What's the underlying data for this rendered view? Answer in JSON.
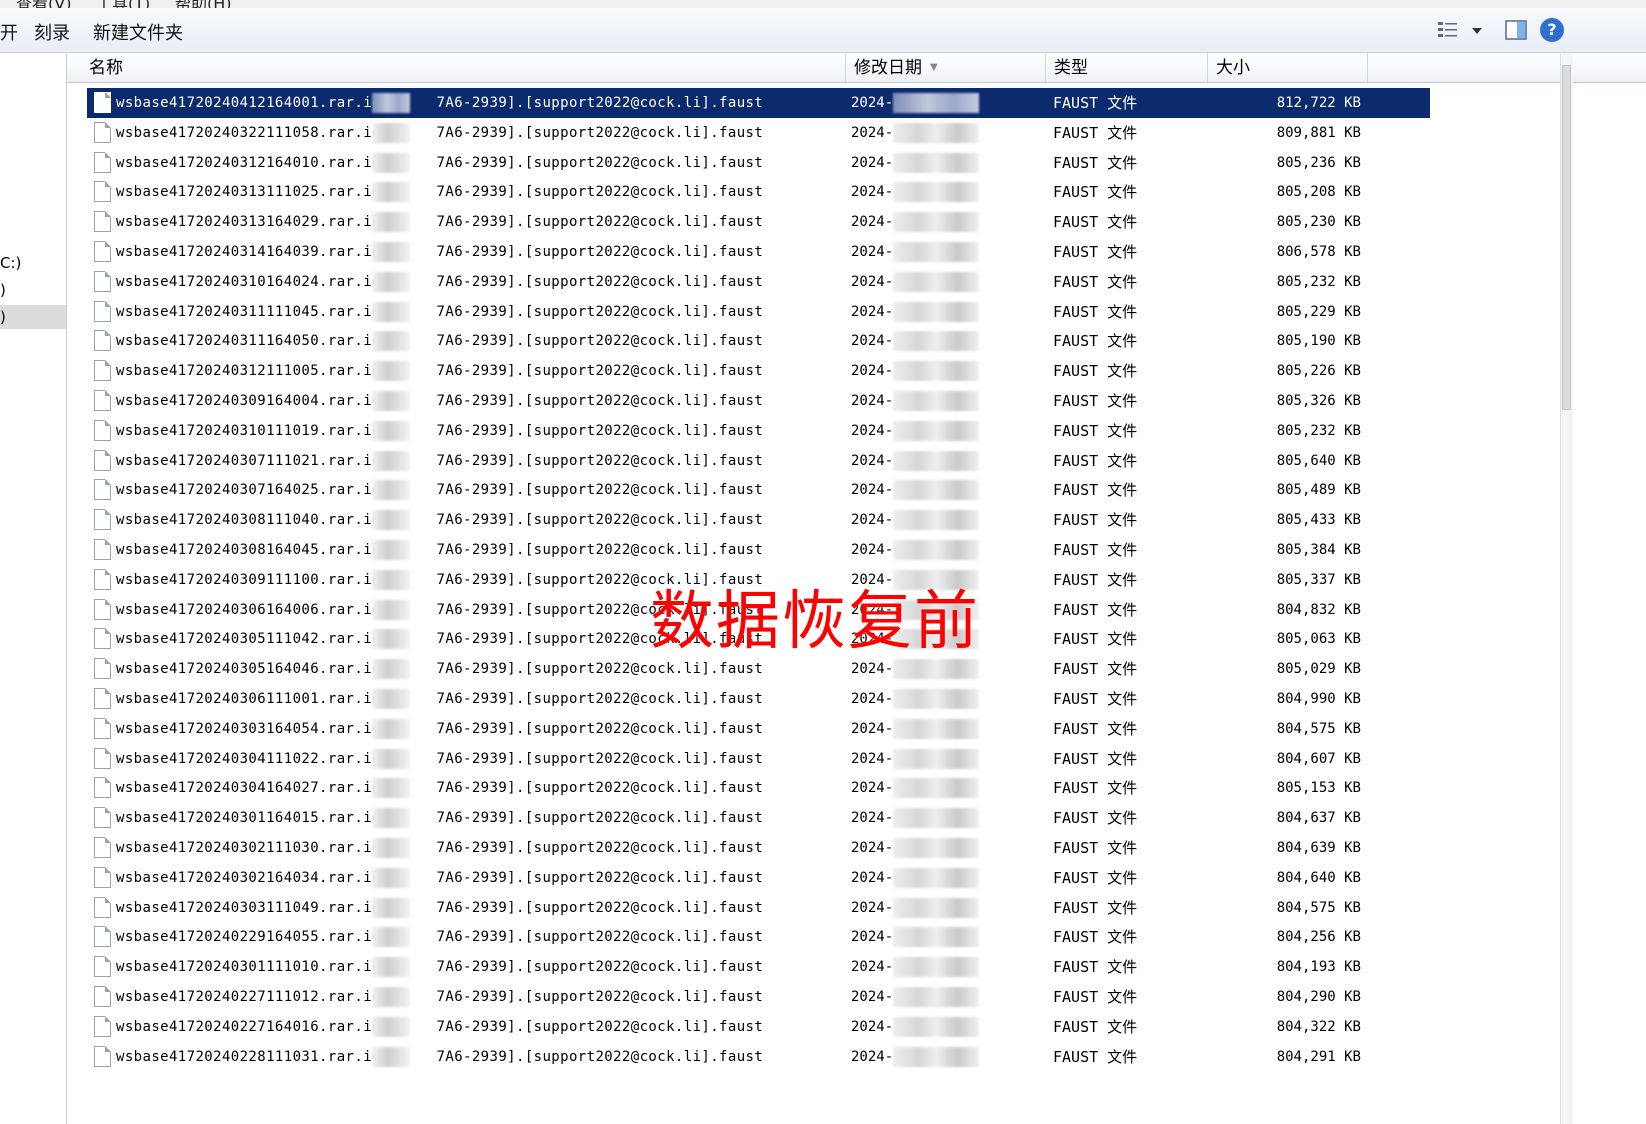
{
  "menubar": [
    "查看(V)",
    "工具(T)",
    "帮助(H)"
  ],
  "toolbar": {
    "open_label": "开",
    "burn_label": "刻录",
    "new_folder_label": "新建文件夹",
    "view_icon": "view-options-icon",
    "help_label": "?"
  },
  "nav": {
    "items": [
      "C:)",
      ")",
      ")"
    ]
  },
  "columns": {
    "name": "名称",
    "date": "修改日期",
    "type": "类型",
    "size": "大小"
  },
  "files": [
    {
      "name": "wsbase41720240412164001.rar.id[8",
      "suffix": "7A6-2939].[support2022@cock.li].faust",
      "date": "2024-",
      "type": "FAUST 文件",
      "size": "812,722 KB",
      "selected": true
    },
    {
      "name": "wsbase41720240322111058.rar.id[8",
      "suffix": "7A6-2939].[support2022@cock.li].faust",
      "date": "2024-",
      "type": "FAUST 文件",
      "size": "809,881 KB"
    },
    {
      "name": "wsbase41720240312164010.rar.id[8",
      "suffix": "7A6-2939].[support2022@cock.li].faust",
      "date": "2024-",
      "type": "FAUST 文件",
      "size": "805,236 KB"
    },
    {
      "name": "wsbase41720240313111025.rar.id[8",
      "suffix": "7A6-2939].[support2022@cock.li].faust",
      "date": "2024-",
      "type": "FAUST 文件",
      "size": "805,208 KB"
    },
    {
      "name": "wsbase41720240313164029.rar.id[8",
      "suffix": "7A6-2939].[support2022@cock.li].faust",
      "date": "2024-",
      "type": "FAUST 文件",
      "size": "805,230 KB"
    },
    {
      "name": "wsbase41720240314164039.rar.id[8",
      "suffix": "7A6-2939].[support2022@cock.li].faust",
      "date": "2024-",
      "type": "FAUST 文件",
      "size": "806,578 KB"
    },
    {
      "name": "wsbase41720240310164024.rar.id[8",
      "suffix": "7A6-2939].[support2022@cock.li].faust",
      "date": "2024-",
      "type": "FAUST 文件",
      "size": "805,232 KB"
    },
    {
      "name": "wsbase41720240311111045.rar.id[8",
      "suffix": "7A6-2939].[support2022@cock.li].faust",
      "date": "2024-",
      "type": "FAUST 文件",
      "size": "805,229 KB"
    },
    {
      "name": "wsbase41720240311164050.rar.id[8",
      "suffix": "7A6-2939].[support2022@cock.li].faust",
      "date": "2024-",
      "type": "FAUST 文件",
      "size": "805,190 KB"
    },
    {
      "name": "wsbase41720240312111005.rar.id[8",
      "suffix": "7A6-2939].[support2022@cock.li].faust",
      "date": "2024-",
      "type": "FAUST 文件",
      "size": "805,226 KB"
    },
    {
      "name": "wsbase41720240309164004.rar.id[8",
      "suffix": "7A6-2939].[support2022@cock.li].faust",
      "date": "2024-",
      "type": "FAUST 文件",
      "size": "805,326 KB"
    },
    {
      "name": "wsbase41720240310111019.rar.id[8",
      "suffix": "7A6-2939].[support2022@cock.li].faust",
      "date": "2024-",
      "type": "FAUST 文件",
      "size": "805,232 KB"
    },
    {
      "name": "wsbase41720240307111021.rar.id[8",
      "suffix": "7A6-2939].[support2022@cock.li].faust",
      "date": "2024-",
      "type": "FAUST 文件",
      "size": "805,640 KB"
    },
    {
      "name": "wsbase41720240307164025.rar.id[8",
      "suffix": "7A6-2939].[support2022@cock.li].faust",
      "date": "2024-",
      "type": "FAUST 文件",
      "size": "805,489 KB"
    },
    {
      "name": "wsbase41720240308111040.rar.id[8",
      "suffix": "7A6-2939].[support2022@cock.li].faust",
      "date": "2024-",
      "type": "FAUST 文件",
      "size": "805,433 KB"
    },
    {
      "name": "wsbase41720240308164045.rar.id[8",
      "suffix": "7A6-2939].[support2022@cock.li].faust",
      "date": "2024-",
      "type": "FAUST 文件",
      "size": "805,384 KB"
    },
    {
      "name": "wsbase41720240309111100.rar.id[8",
      "suffix": "7A6-2939].[support2022@cock.li].faust",
      "date": "2024-",
      "type": "FAUST 文件",
      "size": "805,337 KB"
    },
    {
      "name": "wsbase41720240306164006.rar.id[8",
      "suffix": "7A6-2939].[support2022@cock.li].faust",
      "date": "2024-",
      "type": "FAUST 文件",
      "size": "804,832 KB"
    },
    {
      "name": "wsbase41720240305111042.rar.id[8",
      "suffix": "7A6-2939].[support2022@cock.li].faust",
      "date": "2024-",
      "type": "FAUST 文件",
      "size": "805,063 KB"
    },
    {
      "name": "wsbase41720240305164046.rar.id[8",
      "suffix": "7A6-2939].[support2022@cock.li].faust",
      "date": "2024-",
      "type": "FAUST 文件",
      "size": "805,029 KB"
    },
    {
      "name": "wsbase41720240306111001.rar.id[8",
      "suffix": "7A6-2939].[support2022@cock.li].faust",
      "date": "2024-",
      "type": "FAUST 文件",
      "size": "804,990 KB"
    },
    {
      "name": "wsbase41720240303164054.rar.id[8",
      "suffix": "7A6-2939].[support2022@cock.li].faust",
      "date": "2024-",
      "type": "FAUST 文件",
      "size": "804,575 KB"
    },
    {
      "name": "wsbase41720240304111022.rar.id[8",
      "suffix": "7A6-2939].[support2022@cock.li].faust",
      "date": "2024-",
      "type": "FAUST 文件",
      "size": "804,607 KB"
    },
    {
      "name": "wsbase41720240304164027.rar.id[8",
      "suffix": "7A6-2939].[support2022@cock.li].faust",
      "date": "2024-",
      "type": "FAUST 文件",
      "size": "805,153 KB"
    },
    {
      "name": "wsbase41720240301164015.rar.id[8",
      "suffix": "7A6-2939].[support2022@cock.li].faust",
      "date": "2024-",
      "type": "FAUST 文件",
      "size": "804,637 KB"
    },
    {
      "name": "wsbase41720240302111030.rar.id[8",
      "suffix": "7A6-2939].[support2022@cock.li].faust",
      "date": "2024-",
      "type": "FAUST 文件",
      "size": "804,639 KB"
    },
    {
      "name": "wsbase41720240302164034.rar.id[8",
      "suffix": "7A6-2939].[support2022@cock.li].faust",
      "date": "2024-",
      "type": "FAUST 文件",
      "size": "804,640 KB"
    },
    {
      "name": "wsbase41720240303111049.rar.id[8",
      "suffix": "7A6-2939].[support2022@cock.li].faust",
      "date": "2024-",
      "type": "FAUST 文件",
      "size": "804,575 KB"
    },
    {
      "name": "wsbase41720240229164055.rar.id[8",
      "suffix": "7A6-2939].[support2022@cock.li].faust",
      "date": "2024-",
      "type": "FAUST 文件",
      "size": "804,256 KB"
    },
    {
      "name": "wsbase41720240301111010.rar.id[8",
      "suffix": "7A6-2939].[support2022@cock.li].faust",
      "date": "2024-",
      "type": "FAUST 文件",
      "size": "804,193 KB"
    },
    {
      "name": "wsbase41720240227111012.rar.id[8",
      "suffix": "7A6-2939].[support2022@cock.li].faust",
      "date": "2024-",
      "type": "FAUST 文件",
      "size": "804,290 KB"
    },
    {
      "name": "wsbase41720240227164016.rar.id[8",
      "suffix": "7A6-2939].[support2022@cock.li].faust",
      "date": "2024-",
      "type": "FAUST 文件",
      "size": "804,322 KB"
    },
    {
      "name": "wsbase41720240228111031.rar.id[8",
      "suffix": "7A6-2939].[support2022@cock.li].faust",
      "date": "2024-",
      "type": "FAUST 文件",
      "size": "804,291 KB"
    }
  ],
  "overlay": {
    "stamp_text": "数据恢复前",
    "color": "#ff0000"
  },
  "colors": {
    "selection": "#0b2b6e",
    "help_icon": "#2f6fcf"
  }
}
